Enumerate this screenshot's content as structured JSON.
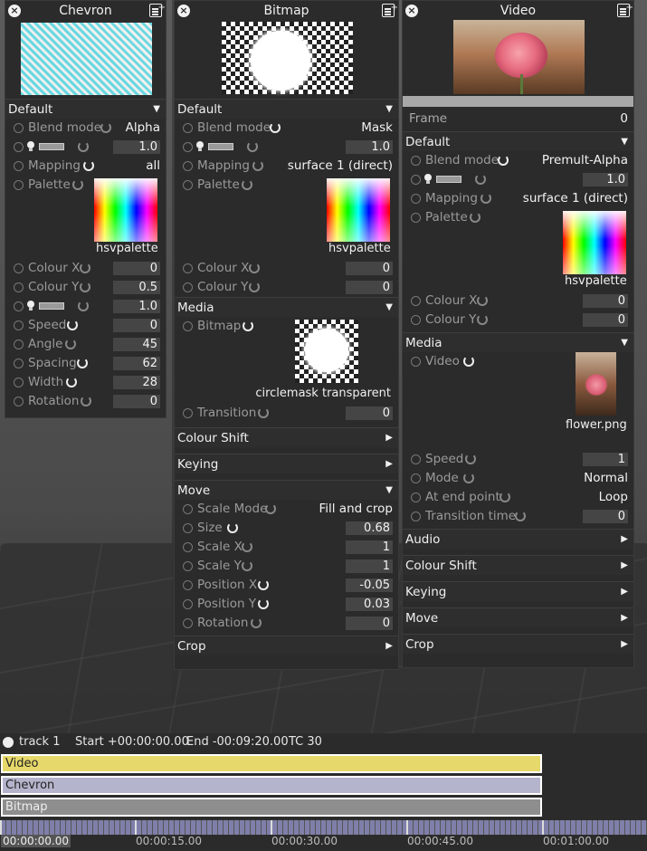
{
  "panels": {
    "chevron": {
      "title": "Chevron",
      "section_default": "Default",
      "blend_mode_label": "Blend mode",
      "blend_mode_value": "Alpha",
      "opacity_value": "1.0",
      "mapping_label": "Mapping",
      "mapping_value": "all",
      "palette_label": "Palette",
      "palette_caption": "hsvpalette",
      "colour_x_label": "Colour X",
      "colour_x_value": "0",
      "colour_y_label": "Colour Y",
      "colour_y_value": "0.5",
      "opacity2_value": "1.0",
      "speed_label": "Speed",
      "speed_value": "0",
      "angle_label": "Angle",
      "angle_value": "45",
      "spacing_label": "Spacing",
      "spacing_value": "62",
      "width_label": "Width",
      "width_value": "28",
      "rotation_label": "Rotation",
      "rotation_value": "0"
    },
    "bitmap": {
      "title": "Bitmap",
      "section_default": "Default",
      "blend_mode_label": "Blend mode",
      "blend_mode_value": "Mask",
      "opacity_value": "1.0",
      "mapping_label": "Mapping",
      "mapping_value": "surface 1 (direct)",
      "palette_label": "Palette",
      "palette_caption": "hsvpalette",
      "colour_x_label": "Colour X",
      "colour_x_value": "0",
      "colour_y_label": "Colour Y",
      "colour_y_value": "0",
      "section_media": "Media",
      "bitmap_label": "Bitmap",
      "bitmap_caption": "circlemask transparent",
      "transition_label": "Transition",
      "transition_value": "0",
      "section_colour_shift": "Colour Shift",
      "section_keying": "Keying",
      "section_move": "Move",
      "scale_mode_label": "Scale Mode",
      "scale_mode_value": "Fill and crop",
      "size_label": "Size",
      "size_value": "0.68",
      "scale_x_label": "Scale X",
      "scale_x_value": "1",
      "scale_y_label": "Scale Y",
      "scale_y_value": "1",
      "position_x_label": "Position X",
      "position_x_value": "-0.05",
      "position_y_label": "Position Y",
      "position_y_value": "0.03",
      "rotation_label": "Rotation",
      "rotation_value": "0",
      "section_crop": "Crop"
    },
    "video": {
      "title": "Video",
      "frame_label": "Frame",
      "frame_value": "0",
      "section_default": "Default",
      "blend_mode_label": "Blend mode",
      "blend_mode_value": "Premult-Alpha",
      "opacity_value": "1.0",
      "mapping_label": "Mapping",
      "mapping_value": "surface 1 (direct)",
      "palette_label": "Palette",
      "palette_caption": "hsvpalette",
      "colour_x_label": "Colour X",
      "colour_x_value": "0",
      "colour_y_label": "Colour Y",
      "colour_y_value": "0",
      "section_media": "Media",
      "video_label": "Video",
      "video_caption": "flower.png",
      "speed_label": "Speed",
      "speed_value": "1",
      "mode_label": "Mode",
      "mode_value": "Normal",
      "end_point_label": "At end point",
      "end_point_value": "Loop",
      "transition_time_label": "Transition time",
      "transition_time_value": "0",
      "section_audio": "Audio",
      "section_colour_shift": "Colour Shift",
      "section_keying": "Keying",
      "section_move": "Move",
      "section_crop": "Crop"
    }
  },
  "timeline": {
    "track_name": "track 1",
    "start": "Start +00:00:00.00",
    "end": "End -00:09:20.00",
    "tc": "TC 30",
    "tracks": [
      "Video",
      "Chevron",
      "Bitmap"
    ],
    "ticks": [
      "00:00:00.00",
      "00:00:15.00",
      "00:00:30.00",
      "00:00:45.00",
      "00:01:00.00"
    ]
  },
  "colors": {
    "video_track": "#e6d86a",
    "chevron_track": "#b4b4cc",
    "bitmap_track": "#8e8e8e",
    "ruler": "#7f7faa"
  }
}
